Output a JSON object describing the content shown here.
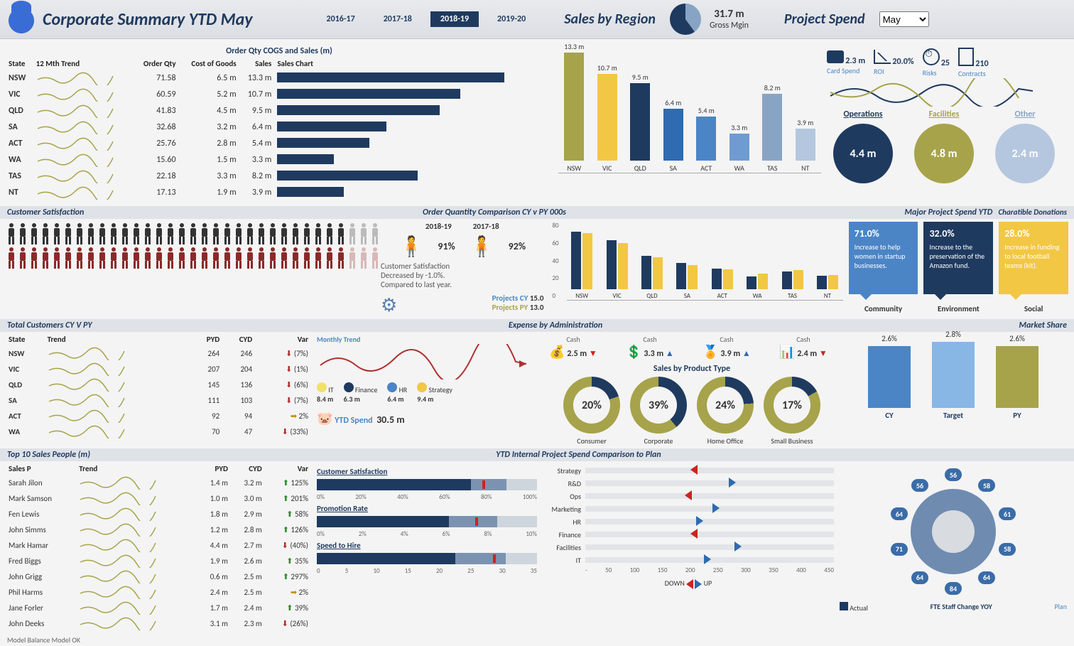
{
  "header": {
    "title": "Corporate Summary YTD May",
    "years": [
      "2016-17",
      "2017-18",
      "2018-19",
      "2019-20"
    ],
    "active_year": "2018-19",
    "sales_region": "Sales by Region",
    "gross_mgin": {
      "value": "31.7 m",
      "label": "Gross Mgin"
    },
    "project_spend": "Project Spend",
    "month_select": "May"
  },
  "kpis": {
    "card_spend": {
      "value": "2.3 m",
      "label": "Card Spend"
    },
    "roi": {
      "value": "20.0%",
      "label": "ROI"
    },
    "risks": {
      "value": "25",
      "label": "Risks"
    },
    "contracts": {
      "value": "210",
      "label": "Contracts"
    }
  },
  "project_spend_circles": {
    "operations": {
      "label": "Operations",
      "value": "4.4 m",
      "color": "#1f3a5f"
    },
    "facilities": {
      "label": "Facilities",
      "value": "4.8 m",
      "color": "#a6a34b"
    },
    "other": {
      "label": "Other",
      "value": "2.4 m",
      "color": "#b5c7de"
    }
  },
  "state_table": {
    "title": "Order Qty COGS and Sales (m)",
    "headers": [
      "State",
      "12 Mth Trend",
      "Order Qty",
      "Cost of Goods",
      "Sales",
      "Sales Chart"
    ],
    "rows": [
      {
        "state": "NSW",
        "qty": "71.58",
        "cogs": "6.5 m",
        "sales": "13.3 m",
        "bar": 13.3
      },
      {
        "state": "VIC",
        "qty": "60.59",
        "cogs": "5.2 m",
        "sales": "10.7 m",
        "bar": 10.7
      },
      {
        "state": "QLD",
        "qty": "41.83",
        "cogs": "4.5 m",
        "sales": "9.5 m",
        "bar": 9.5
      },
      {
        "state": "SA",
        "qty": "32.68",
        "cogs": "3.2 m",
        "sales": "6.4 m",
        "bar": 6.4
      },
      {
        "state": "ACT",
        "qty": "25.76",
        "cogs": "2.8 m",
        "sales": "5.4 m",
        "bar": 5.4
      },
      {
        "state": "WA",
        "qty": "15.60",
        "cogs": "1.5 m",
        "sales": "3.3 m",
        "bar": 3.3
      },
      {
        "state": "TAS",
        "qty": "22.18",
        "cogs": "3.3 m",
        "sales": "8.2 m",
        "bar": 8.2
      },
      {
        "state": "NT",
        "qty": "17.13",
        "cogs": "1.9 m",
        "sales": "3.9 m",
        "bar": 3.9
      }
    ]
  },
  "chart_data": {
    "sales_by_region_bar": {
      "type": "bar",
      "categories": [
        "NSW",
        "VIC",
        "QLD",
        "SA",
        "ACT",
        "WA",
        "TAS",
        "NT"
      ],
      "values": [
        13.3,
        10.7,
        9.5,
        6.4,
        5.4,
        3.3,
        8.2,
        3.9
      ],
      "colors": [
        "#a6a34b",
        "#f2c744",
        "#1f3a5f",
        "#2e6bb0",
        "#4b85c6",
        "#6f9bd1",
        "#88a4c4",
        "#b5c7de"
      ],
      "ylim": [
        0,
        14
      ],
      "ylabel": "m"
    },
    "order_qty_compare": {
      "type": "bar",
      "title": "Order Quantity Comparison CY v PY 000s",
      "categories": [
        "NSW",
        "VIC",
        "QLD",
        "SA",
        "ACT",
        "WA",
        "TAS",
        "NT"
      ],
      "series": [
        {
          "name": "CY",
          "color": "#1f3a5f",
          "values": [
            72,
            61,
            42,
            33,
            26,
            16,
            22,
            17
          ]
        },
        {
          "name": "PY",
          "color": "#f2c744",
          "values": [
            70,
            58,
            40,
            30,
            25,
            20,
            24,
            18
          ]
        }
      ],
      "ylim": [
        0,
        80
      ]
    },
    "market_share": {
      "type": "bar",
      "categories": [
        "CY",
        "Target",
        "PY"
      ],
      "values": [
        2.6,
        2.8,
        2.6
      ],
      "colors": [
        "#4b85c6",
        "#88b7e6",
        "#a6a34b"
      ],
      "title": "Market Share"
    },
    "expense_admin": {
      "type": "scatter",
      "title": "Expense by Administration",
      "subtitle": "Monthly Trend",
      "series": [
        {
          "name": "IT",
          "color": "#f2e26b",
          "value": 8.4
        },
        {
          "name": "Finance",
          "color": "#1f3a5f",
          "value": 6.3
        },
        {
          "name": "HR",
          "color": "#4b85c6",
          "value": 6.4
        },
        {
          "name": "Strategy",
          "color": "#f2c744",
          "value": 9.4
        }
      ],
      "ytd_spend": "30.5 m"
    },
    "ytd_plan_compare": {
      "type": "bar",
      "title": "YTD Internal Project Spend Comparison to Plan",
      "categories": [
        "Strategy",
        "R&D",
        "Ops",
        "Marketing",
        "HR",
        "Finance",
        "Facilities",
        "IT"
      ],
      "actual": [
        190,
        260,
        180,
        230,
        200,
        190,
        270,
        215
      ],
      "plan": [
        200,
        200,
        200,
        200,
        200,
        200,
        200,
        200
      ],
      "xlim": [
        0,
        450
      ]
    }
  },
  "customer_sat": {
    "title": "Customer Satisfaction",
    "cy_label": "2018-19",
    "py_label": "2017-18",
    "cy_pct": "91%",
    "py_pct": "92%",
    "note_h": "Customer Satisfaction",
    "note": "Decreased by -1.0%.\nCompared to last year.",
    "projects_cy": {
      "label": "Projects CY",
      "value": "15.0"
    },
    "projects_py": {
      "label": "Projects PY",
      "value": "13.0"
    }
  },
  "major_spend": {
    "title": "Major Project Spend YTD",
    "sub": "Charatible Donations",
    "cards": [
      {
        "pct": "71.0%",
        "text": "Increase to help women in startup businesses.",
        "color": "#4b85c6",
        "label": "Community"
      },
      {
        "pct": "32.0%",
        "text": "Increase to the preservation of the Amazon fund.",
        "color": "#1f3a5f",
        "label": "Environment"
      },
      {
        "pct": "28.0%",
        "text": "Increase in funding to local football teams (kit).",
        "color": "#f2c744",
        "label": "Social"
      }
    ]
  },
  "customers_table": {
    "title": "Total Customers CY V PY",
    "headers": [
      "State",
      "Trend",
      "PYD",
      "CYD",
      "Var"
    ],
    "rows": [
      {
        "state": "NSW",
        "pyd": "264",
        "cyd": "246",
        "var": "(7%)",
        "dir": "dn"
      },
      {
        "state": "VIC",
        "pyd": "207",
        "cyd": "204",
        "var": "(1%)",
        "dir": "dn"
      },
      {
        "state": "QLD",
        "pyd": "145",
        "cyd": "136",
        "var": "(6%)",
        "dir": "dn"
      },
      {
        "state": "SA",
        "pyd": "111",
        "cyd": "103",
        "var": "(7%)",
        "dir": "dn"
      },
      {
        "state": "ACT",
        "pyd": "92",
        "cyd": "94",
        "var": "2%",
        "dir": "flat"
      },
      {
        "state": "WA",
        "pyd": "70",
        "cyd": "47",
        "var": "(33%)",
        "dir": "dn"
      }
    ]
  },
  "cash": [
    {
      "label": "Cash",
      "value": "2.5 m",
      "icon": "coins",
      "dir": "dn"
    },
    {
      "label": "Cash",
      "value": "3.3 m",
      "icon": "dollar",
      "dir": "up"
    },
    {
      "label": "Cash",
      "value": "3.9 m",
      "icon": "badge",
      "dir": "up"
    },
    {
      "label": "Cash",
      "value": "2.4 m",
      "icon": "bars",
      "dir": "dn"
    }
  ],
  "product_type": {
    "title": "Sales by Product Type",
    "items": [
      {
        "label": "Consumer",
        "pct": 20
      },
      {
        "label": "Corporate",
        "pct": 39
      },
      {
        "label": "Home Office",
        "pct": 24
      },
      {
        "label": "Small Business",
        "pct": 17
      }
    ]
  },
  "market_share_title": "Market Share",
  "salespeople": {
    "title": "Top 10 Sales People (m)",
    "headers": [
      "Sales P",
      "Trend",
      "PYD",
      "CYD",
      "Var"
    ],
    "rows": [
      {
        "name": "Sarah Jilon",
        "pyd": "1.4 m",
        "cyd": "3.2 m",
        "var": "125%",
        "dir": "up"
      },
      {
        "name": "Mark Samson",
        "pyd": "1.0 m",
        "cyd": "3.0 m",
        "var": "201%",
        "dir": "up"
      },
      {
        "name": "Fen Lewis",
        "pyd": "1.8 m",
        "cyd": "2.9 m",
        "var": "58%",
        "dir": "up"
      },
      {
        "name": "John Simms",
        "pyd": "1.2 m",
        "cyd": "2.8 m",
        "var": "126%",
        "dir": "up"
      },
      {
        "name": "Mark Hamar",
        "pyd": "4.4 m",
        "cyd": "2.7 m",
        "var": "(40%)",
        "dir": "dn"
      },
      {
        "name": "Fred Biggs",
        "pyd": "1.9 m",
        "cyd": "2.6 m",
        "var": "35%",
        "dir": "up"
      },
      {
        "name": "John Grigg",
        "pyd": "0.6 m",
        "cyd": "2.5 m",
        "var": "297%",
        "dir": "up"
      },
      {
        "name": "Phil Harms",
        "pyd": "2.4 m",
        "cyd": "2.5 m",
        "var": "2%",
        "dir": "flat"
      },
      {
        "name": "Jane Forler",
        "pyd": "1.7 m",
        "cyd": "2.4 m",
        "var": "39%",
        "dir": "up"
      },
      {
        "name": "John Deeks",
        "pyd": "3.1 m",
        "cyd": "2.3 m",
        "var": "(26%)",
        "dir": "dn"
      }
    ]
  },
  "bullets": {
    "csat": {
      "title": "Customer Satisfaction",
      "value": 70,
      "mid": 86,
      "target": 75,
      "scale": [
        "0%",
        "20%",
        "40%",
        "60%",
        "80%",
        "100%"
      ]
    },
    "promo": {
      "title": "Promotion Rate",
      "value": 6.0,
      "mid": 8.2,
      "target": 7.2,
      "scale": [
        "0%",
        "2%",
        "4%",
        "6%",
        "8%",
        "10%"
      ]
    },
    "hire": {
      "title": "Speed to Hire",
      "value": 22,
      "mid": 30,
      "target": 28,
      "scale": [
        "0",
        "5",
        "10",
        "15",
        "20",
        "25",
        "30",
        "35"
      ]
    }
  },
  "fte": {
    "title": "FTE Staff Change YOY",
    "actual": "Actual",
    "plan": "Plan",
    "values": [
      56,
      58,
      61,
      58,
      64,
      84,
      64,
      71,
      64,
      56
    ]
  },
  "legend": {
    "down": "DOWN",
    "up": "UP"
  },
  "footer": {
    "left": "Model Balance   Model OK"
  }
}
